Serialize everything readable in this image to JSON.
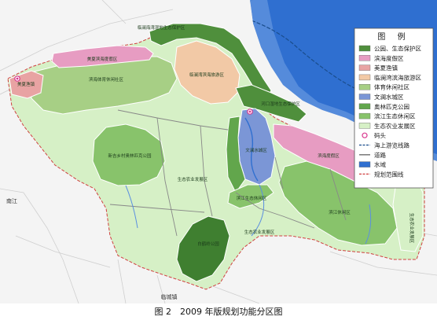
{
  "caption": "图 2　2009 年版规划功能分区图",
  "legend": {
    "title": "图 例",
    "items": [
      {
        "label": "公园、生态保护区",
        "color": "#4f8f3c",
        "kind": "fill"
      },
      {
        "label": "滨海度假区",
        "color": "#e79cc2",
        "kind": "fill"
      },
      {
        "label": "美夏渔镇",
        "color": "#e8a3a3",
        "kind": "fill"
      },
      {
        "label": "临澜湾滨海旅游区",
        "color": "#f2c9a6",
        "kind": "fill"
      },
      {
        "label": "体育休闲社区",
        "color": "#a7cf85",
        "kind": "fill"
      },
      {
        "label": "文澜水城区",
        "color": "#7b96d6",
        "kind": "fill"
      },
      {
        "label": "奥林匹克公园",
        "color": "#62a64c",
        "kind": "fill"
      },
      {
        "label": "滨江生态休闲区",
        "color": "#88c36b",
        "kind": "fill"
      },
      {
        "label": "生态农业发展区",
        "color": "#d6f0c6",
        "kind": "fill"
      },
      {
        "label": "码头",
        "color": "#d9388f",
        "kind": "dock"
      },
      {
        "label": "海上游览线路",
        "color": "#1a4d8c",
        "kind": "sealine"
      },
      {
        "label": "道路",
        "color": "#808080",
        "kind": "road"
      },
      {
        "label": "水域",
        "color": "#2f6fd0",
        "kind": "water"
      },
      {
        "label": "规划范围线",
        "color": "#d04040",
        "kind": "boundary"
      }
    ]
  },
  "zones": {
    "north_wetland": "临澜海湾湿地生态保护区",
    "coast_resort": "美夏滨海度假区",
    "fishing_town": "美夏渔镇",
    "sports_community": "滨海体育休闲社区",
    "lanwan_tourism": "临澜湾滨海旅游区",
    "estuary_reserve": "河口湿地生态保护区",
    "water_city": "文澜水城区",
    "east_resort": "滨海度假区",
    "olympic_park": "新吉乡村奥林匹克公园",
    "eco_agri_1": "生态农业发展区",
    "eco_agri_2": "生态农业发展区",
    "binjiang": "滨江生态休闲区",
    "riverside_park": "滨江休闲区",
    "baijing_park": "白鹤岭公园",
    "east_agri": "生态农业发展区"
  },
  "towns": {
    "lincheng": "临城镇",
    "nanjiang": "南江"
  }
}
